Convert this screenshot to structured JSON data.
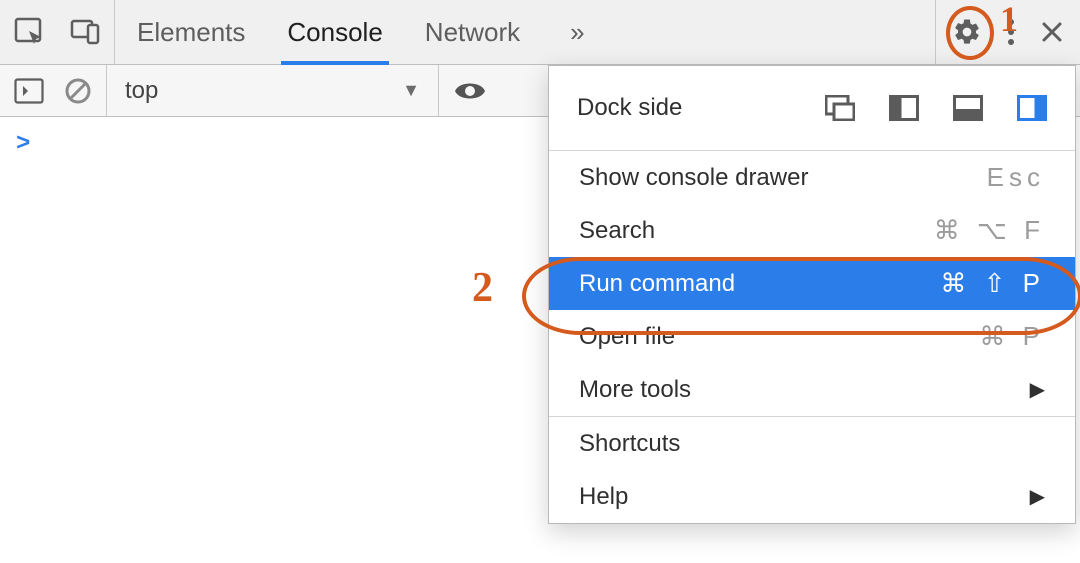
{
  "tabs": {
    "elements": "Elements",
    "console": "Console",
    "network": "Network"
  },
  "toolbar": {
    "context": "top"
  },
  "console": {
    "prompt": ">"
  },
  "menu": {
    "dock_label": "Dock side",
    "show_console_drawer": {
      "label": "Show console drawer",
      "shortcut": "Esc"
    },
    "search": {
      "label": "Search",
      "shortcut": "⌘ ⌥ F"
    },
    "run_command": {
      "label": "Run command",
      "shortcut": "⌘ ⇧ P"
    },
    "open_file": {
      "label": "Open file",
      "shortcut": "⌘ P"
    },
    "more_tools": {
      "label": "More tools"
    },
    "shortcuts": {
      "label": "Shortcuts"
    },
    "help": {
      "label": "Help"
    }
  },
  "annotations": {
    "one": "1",
    "two": "2"
  }
}
